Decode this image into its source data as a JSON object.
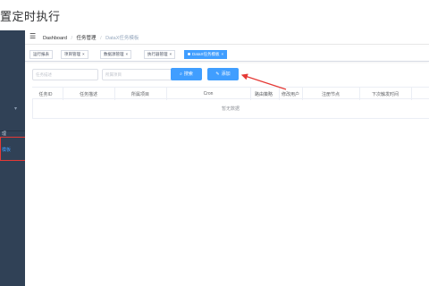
{
  "page_title": "置定时执行",
  "sidebar": {
    "items": [
      {
        "label": "理",
        "active": false
      },
      {
        "label": "模板",
        "active": true
      }
    ]
  },
  "navbar": {
    "breadcrumb": [
      "Dashboard",
      "任务管理",
      "DataX任务模板"
    ]
  },
  "tags": [
    {
      "label": "运行报表",
      "active": false
    },
    {
      "label": "项目管理",
      "active": false
    },
    {
      "label": "数据源管理",
      "active": false
    },
    {
      "label": "执行器管理",
      "active": false
    },
    {
      "label": "DataX任务模板",
      "active": true
    }
  ],
  "filters": {
    "task_desc_placeholder": "任务描述",
    "project_placeholder": "所属项目"
  },
  "buttons": {
    "search": "搜索",
    "add": "添加"
  },
  "table": {
    "columns": [
      "任务ID",
      "任务描述",
      "所属项目",
      "Cron",
      "路由策略",
      "修改用户",
      "注册节点",
      "下次触发时间"
    ],
    "empty_text": "暂无数据"
  },
  "colors": {
    "primary": "#409eff",
    "sidebar": "#304156",
    "annotation": "#e53935"
  }
}
